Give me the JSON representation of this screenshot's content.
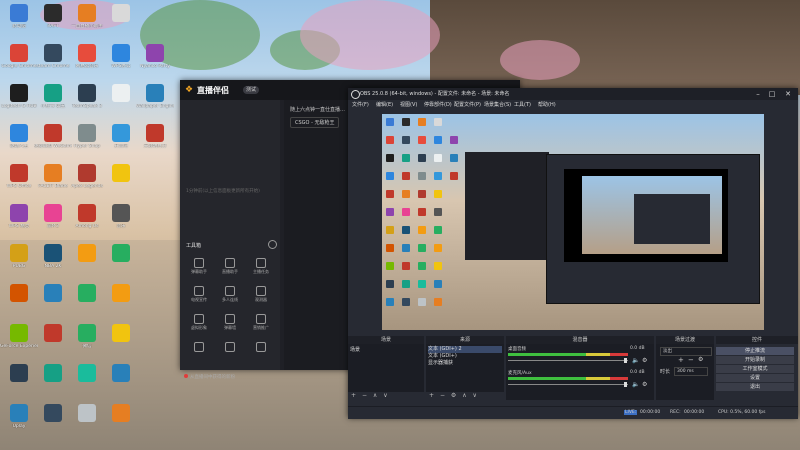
{
  "desktop": {
    "icons": [
      {
        "label": "此电脑",
        "color": "#3a7bd5",
        "col": 0,
        "row": 0
      },
      {
        "label": "RAFT",
        "color": "#2b2b2b",
        "col": 1,
        "row": 0
      },
      {
        "label": "一直直播小助手",
        "color": "#e67e22",
        "col": 2,
        "row": 0
      },
      {
        "label": "",
        "color": "#d9d9d9",
        "col": 3,
        "row": 0
      },
      {
        "label": "Google Chrome",
        "color": "#db4437",
        "col": 0,
        "row": 1
      },
      {
        "label": "steam Chrome",
        "color": "#34495e",
        "col": 1,
        "row": 1
      },
      {
        "label": "网易云音乐",
        "color": "#e74c3c",
        "col": 2,
        "row": 1
      },
      {
        "label": "WPS办公",
        "color": "#2e86de",
        "col": 3,
        "row": 1
      },
      {
        "label": "Nyanco Party",
        "color": "#8e44ad",
        "col": 4,
        "row": 1
      },
      {
        "label": "Logitech G HUB",
        "color": "#1e1e1e",
        "col": 0,
        "row": 2
      },
      {
        "label": "小红书 第五",
        "color": "#16a085",
        "col": 1,
        "row": 2
      },
      {
        "label": "TeamSpeak 3",
        "color": "#2c3e50",
        "col": 2,
        "row": 2
      },
      {
        "label": "",
        "color": "#ecf0f1",
        "col": 3,
        "row": 2
      },
      {
        "label": "Wallpaper Engine",
        "color": "#2980b9",
        "col": 4,
        "row": 2
      },
      {
        "label": "驱动人生",
        "color": "#2e86de",
        "col": 0,
        "row": 3
      },
      {
        "label": "英雄联盟 WeGame",
        "color": "#c0392b",
        "col": 1,
        "row": 3
      },
      {
        "label": "Hyper Snap",
        "color": "#7f8c8d",
        "col": 2,
        "row": 3
      },
      {
        "label": "开黑吧",
        "color": "#3498db",
        "col": 3,
        "row": 3
      },
      {
        "label": "天涯明月刀",
        "color": "#c0392b",
        "col": 4,
        "row": 3
      },
      {
        "label": "WPS Office",
        "color": "#c0392b",
        "col": 0,
        "row": 4
      },
      {
        "label": "FACEIT Blade",
        "color": "#e67e22",
        "col": 1,
        "row": 4
      },
      {
        "label": "Apex Legends",
        "color": "#b03a2e",
        "col": 2,
        "row": 4
      },
      {
        "label": "",
        "color": "#f1c40f",
        "col": 3,
        "row": 4
      },
      {
        "label": "WPS 精灵",
        "color": "#8e44ad",
        "col": 0,
        "row": 5
      },
      {
        "label": "崩坏3",
        "color": "#e84393",
        "col": 1,
        "row": 5
      },
      {
        "label": "Among Us",
        "color": "#c0392b",
        "col": 2,
        "row": 5
      },
      {
        "label": "音乐",
        "color": "#555555",
        "col": 3,
        "row": 5
      },
      {
        "label": "PUBG",
        "color": "#d4a017",
        "col": 0,
        "row": 6
      },
      {
        "label": "NBA 2K",
        "color": "#1a5276",
        "col": 1,
        "row": 6
      },
      {
        "label": "",
        "color": "#f39c12",
        "col": 2,
        "row": 6
      },
      {
        "label": "",
        "color": "#27ae60",
        "col": 3,
        "row": 6
      },
      {
        "label": "",
        "color": "#d35400",
        "col": 0,
        "row": 7
      },
      {
        "label": "",
        "color": "#2980b9",
        "col": 1,
        "row": 7
      },
      {
        "label": "",
        "color": "#27ae60",
        "col": 2,
        "row": 7
      },
      {
        "label": "",
        "color": "#f39c12",
        "col": 3,
        "row": 7
      },
      {
        "label": "GeForce Experience",
        "color": "#76b900",
        "col": 0,
        "row": 8
      },
      {
        "label": "",
        "color": "#c0392b",
        "col": 1,
        "row": 8
      },
      {
        "label": "微信",
        "color": "#27ae60",
        "col": 2,
        "row": 8
      },
      {
        "label": "",
        "color": "#f1c40f",
        "col": 3,
        "row": 8
      },
      {
        "label": "",
        "color": "#2c3e50",
        "col": 0,
        "row": 9
      },
      {
        "label": "",
        "color": "#16a085",
        "col": 1,
        "row": 9
      },
      {
        "label": "",
        "color": "#1abc9c",
        "col": 2,
        "row": 9
      },
      {
        "label": "",
        "color": "#2980b9",
        "col": 3,
        "row": 9
      },
      {
        "label": "Uplay",
        "color": "#2980b9",
        "col": 0,
        "row": 10
      },
      {
        "label": "",
        "color": "#34495e",
        "col": 1,
        "row": 10
      },
      {
        "label": "",
        "color": "#bdc3c7",
        "col": 2,
        "row": 10
      },
      {
        "label": "",
        "color": "#e67e22",
        "col": 3,
        "row": 10
      }
    ]
  },
  "companion": {
    "title": "直播伴侣",
    "version": "测试",
    "status_text": "1分钟前(以上信息面板更新所有开始)",
    "tools_header": "工具箱",
    "tools": [
      {
        "label": "弹幕助手"
      },
      {
        "label": "直播助手"
      },
      {
        "label": "主播任务"
      },
      {
        "label": "电视宣传"
      },
      {
        "label": "多人连线"
      },
      {
        "label": "观测器"
      },
      {
        "label": "虚拟形象"
      },
      {
        "label": "弹幕墙"
      },
      {
        "label": "营销推广"
      },
      {
        "label": ""
      },
      {
        "label": ""
      },
      {
        "label": ""
      }
    ],
    "bottom_text": "从直播间中获得的新粉",
    "hint": "随上六点钟一直仕直播…",
    "game_select": "CSGO - 无敌枪王",
    "btn1": "开播",
    "btn2": "开始"
  },
  "obs": {
    "title": "OBS 25.0.8 (64-bit, windows) - 配置文件: 未命名 - 场景: 未命名",
    "menu": [
      "文件(F)",
      "编辑(E)",
      "视图(V)",
      "停靠部件(D)",
      "配置文件(P)",
      "场景集合(S)",
      "工具(T)",
      "帮助(H)"
    ],
    "docks": {
      "scenes": "场景",
      "sources": "来源",
      "mixer": "混音器",
      "transitions": "场景过渡",
      "controls": "控件"
    },
    "scene_items": [
      "场景"
    ],
    "source_items": [
      "文本 (GDI+) 2",
      "文本 (GDI+)",
      "显示器捕获"
    ],
    "mixer": [
      {
        "name": "桌面音频",
        "db": "0.0 dB"
      },
      {
        "name": "麦克风/Aux",
        "db": "0.0 dB"
      }
    ],
    "transition": {
      "type": "淡出",
      "duration_label": "时长",
      "duration": "300 ms"
    },
    "controls": [
      "停止推流",
      "开始录制",
      "工作室模式",
      "设置",
      "退出"
    ],
    "status": {
      "live_label": "LIVE:",
      "live": "00:00:00",
      "rec_label": "REC:",
      "rec": "00:00:00",
      "cpu": "CPU: 0.5%, 60.00 fps"
    }
  }
}
